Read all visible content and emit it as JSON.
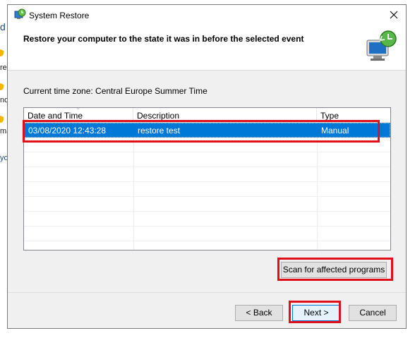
{
  "background": {
    "fragments": [
      "d",
      "rea",
      "nd",
      "ma",
      "yo"
    ]
  },
  "window": {
    "title": "System Restore",
    "header_title": "Restore your computer to the state it was in before the selected event",
    "timezone_label": "Current time zone: Central Europe Summer Time"
  },
  "restore_list": {
    "columns": [
      "Date and Time",
      "Description",
      "Type"
    ],
    "rows": [
      {
        "date": "03/08/2020 12:43:28",
        "description": "restore test",
        "type": "Manual",
        "selected": true
      }
    ]
  },
  "buttons": {
    "scan": "Scan for affected programs",
    "back": "< Back",
    "next": "Next >",
    "cancel": "Cancel"
  },
  "colors": {
    "selection": "#0078d7",
    "highlight": "#e0101a"
  }
}
